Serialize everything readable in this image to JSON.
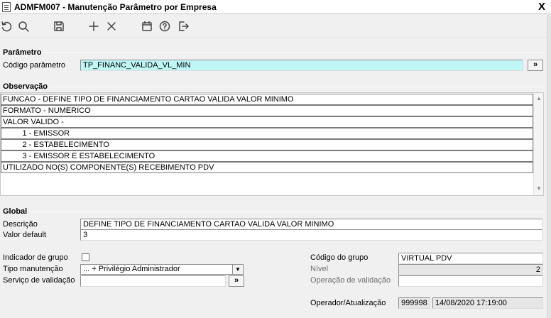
{
  "window": {
    "title": "ADMFM007 - Manutenção Parâmetro por Empresa",
    "close_glyph": "X"
  },
  "toolbar": {
    "icons": [
      "refresh-icon",
      "search-icon",
      "save-icon",
      "add-icon",
      "delete-icon",
      "calendar-icon",
      "help-icon",
      "exit-icon"
    ]
  },
  "parametro": {
    "legend": "Parâmetro",
    "codigo_label": "Código parâmetro",
    "codigo_value": "TP_FINANC_VALIDA_VL_MIN",
    "go_label": "»"
  },
  "observacao": {
    "legend": "Observação",
    "lines": [
      "FUNCAO - DEFINE TIPO DE FINANCIAMENTO CARTAO VALIDA VALOR MINIMO",
      "FORMATO - NUMERICO",
      "VALOR VALIDO -",
      "         1 - EMISSOR",
      "         2 - ESTABELECIMENTO",
      "         3 - EMISSOR E ESTABELECIMENTO",
      "UTILIZADO NO(S) COMPONENTE(S) RECEBIMENTO PDV"
    ],
    "scroll_up": "▲",
    "scroll_down": "▼"
  },
  "global": {
    "legend": "Global",
    "descricao_label": "Descrição",
    "descricao_value": "DEFINE TIPO DE FINANCIAMENTO CARTAO VALIDA VALOR MINIMO",
    "valor_default_label": "Valor default",
    "valor_default_value": "3",
    "indicador_grupo_label": "Indicador de grupo",
    "tipo_manutencao_label": "Tipo manutenção",
    "tipo_manutencao_value": "... + Privilégio Administrador",
    "tipo_manutencao_arrow": "▼",
    "servico_validacao_label": "Serviço de validação",
    "servico_validacao_value": "",
    "servico_go_label": "»",
    "codigo_grupo_label": "Código do grupo",
    "codigo_grupo_value": "VIRTUAL PDV",
    "nivel_label": "Nível",
    "nivel_value": "2",
    "operacao_validacao_label": "Operação de validação",
    "operacao_validacao_value": "",
    "operador_label": "Operador/Atualização",
    "operador_value": "999998",
    "atualizacao_value": "14/08/2020 17:19:00"
  }
}
